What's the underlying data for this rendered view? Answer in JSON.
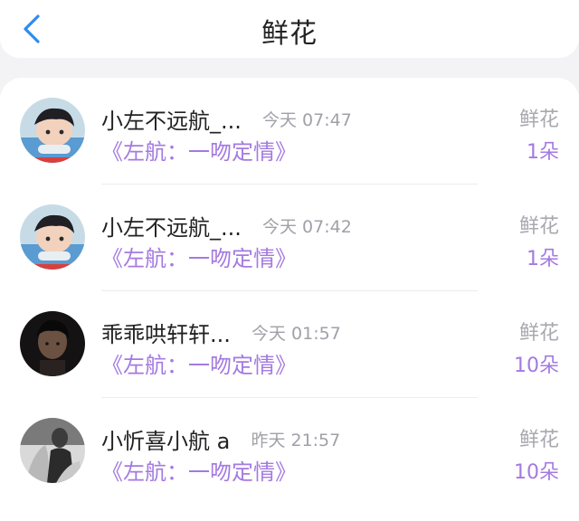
{
  "header": {
    "title": "鲜花",
    "back_icon": "chevron-left-icon",
    "accent_color": "#2d8cf0"
  },
  "list": {
    "items": [
      {
        "name": "小左不远航_...",
        "time": "今天 07:47",
        "work": "《左航：一吻定情》",
        "gift": "鲜花",
        "count": "1朵",
        "avatar": "child-avatar"
      },
      {
        "name": "小左不远航_...",
        "time": "今天 07:42",
        "work": "《左航：一吻定情》",
        "gift": "鲜花",
        "count": "1朵",
        "avatar": "child-avatar"
      },
      {
        "name": "乖乖哄轩轩...",
        "time": "今天 01:57",
        "work": "《左航：一吻定情》",
        "gift": "鲜花",
        "count": "10朵",
        "avatar": "dark-portrait-avatar"
      },
      {
        "name": "小忻喜小航 a",
        "time": "昨天 21:57",
        "work": "《左航：一吻定情》",
        "gift": "鲜花",
        "count": "10朵",
        "avatar": "grayscale-photo-avatar"
      }
    ]
  },
  "colors": {
    "purple_text": "#a47ae0",
    "gray_text": "#a0a0a8",
    "page_bg": "#f3f3f5"
  }
}
